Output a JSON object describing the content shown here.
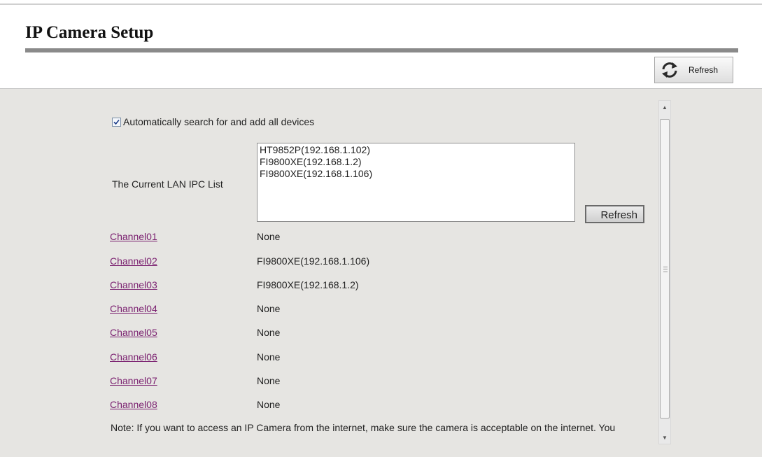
{
  "page": {
    "title": "IP Camera Setup"
  },
  "toolbar": {
    "refresh_label": "Refresh",
    "refresh_icon": "refresh-icon"
  },
  "settings": {
    "auto_search_label": "Automatically search for and add all devices",
    "auto_search_checked": true,
    "lan_list_label": "The Current LAN IPC List",
    "lan_list_items": [
      "HT9852P(192.168.1.102)",
      "FI9800XE(192.168.1.2)",
      "FI9800XE(192.168.1.106)"
    ],
    "list_refresh_label": "Refresh"
  },
  "channels": [
    {
      "name": "Channel01",
      "value": "None"
    },
    {
      "name": "Channel02",
      "value": "FI9800XE(192.168.1.106)"
    },
    {
      "name": "Channel03",
      "value": "FI9800XE(192.168.1.2)"
    },
    {
      "name": "Channel04",
      "value": "None"
    },
    {
      "name": "Channel05",
      "value": "None"
    },
    {
      "name": "Channel06",
      "value": "None"
    },
    {
      "name": "Channel07",
      "value": "None"
    },
    {
      "name": "Channel08",
      "value": "None"
    }
  ],
  "note": "Note: If you want to access an IP Camera from the internet, make sure the camera is acceptable on the internet. You",
  "colors": {
    "link": "#7a1f6f",
    "panel_bg": "#e6e5e2"
  }
}
